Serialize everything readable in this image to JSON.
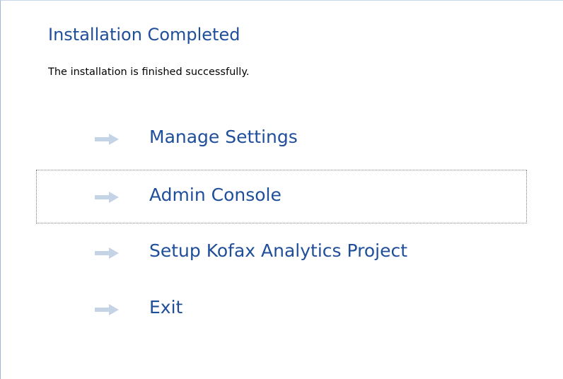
{
  "dialog": {
    "title": "Installation Completed",
    "message": "The installation is finished successfully."
  },
  "actions": [
    {
      "label": "Manage Settings",
      "icon": "arrow-right-icon"
    },
    {
      "label": "Admin Console",
      "icon": "arrow-right-icon",
      "focused": true
    },
    {
      "label": "Setup Kofax Analytics Project",
      "icon": "arrow-right-icon"
    },
    {
      "label": "Exit",
      "icon": "arrow-right-icon"
    }
  ],
  "colors": {
    "title": "#1f4e9a",
    "link": "#1f4e9a",
    "arrow": "#c5d3e6",
    "frame_border": "#9db9d6"
  }
}
